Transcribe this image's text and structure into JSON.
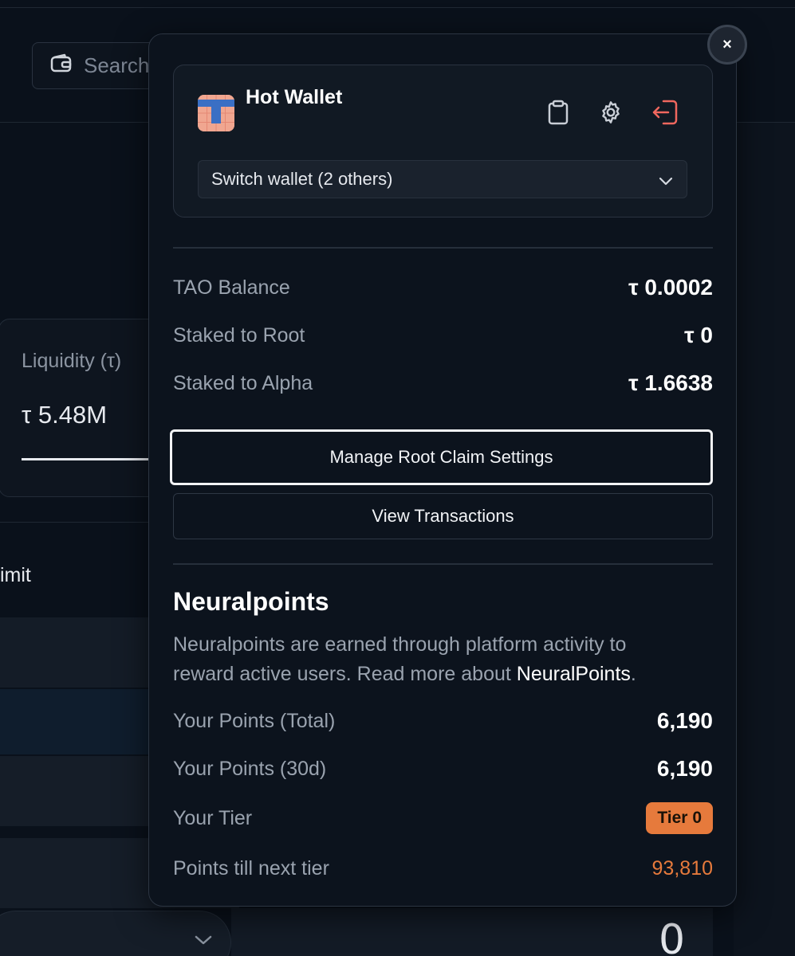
{
  "background": {
    "search_placeholder": "Search",
    "liquidity_label": "Liquidity (τ)",
    "liquidity_value": "τ 5.48M",
    "limit_label": "imit",
    "big_value": "0"
  },
  "wallet": {
    "name": "Hot Wallet",
    "address": "",
    "switch_label": "Switch wallet (2 others)",
    "close_label": "×"
  },
  "balances": [
    {
      "label": "TAO Balance",
      "value": "τ 0.0002"
    },
    {
      "label": "Staked to Root",
      "value": "τ 0"
    },
    {
      "label": "Staked to Alpha",
      "value": "τ 1.6638"
    }
  ],
  "actions": {
    "manage_root": "Manage Root Claim Settings",
    "view_transactions": "View Transactions"
  },
  "neuralpoints": {
    "title": "Neuralpoints",
    "description": "Neuralpoints are earned through platform activity to reward active users. Read more about ",
    "link_text": "NeuralPoints",
    "description_end": ".",
    "total_label": "Your Points (Total)",
    "total_value": "6,190",
    "d30_label": "Your Points (30d)",
    "d30_value": "6,190",
    "tier_label": "Your Tier",
    "tier_value": "Tier 0",
    "next_label": "Points till next tier",
    "next_value": "93,810"
  },
  "colors": {
    "accent_orange": "#e67a3c",
    "logout_red": "#f0675e",
    "avatar_pink": "#f0a690",
    "avatar_blue": "#3a6fc4"
  }
}
